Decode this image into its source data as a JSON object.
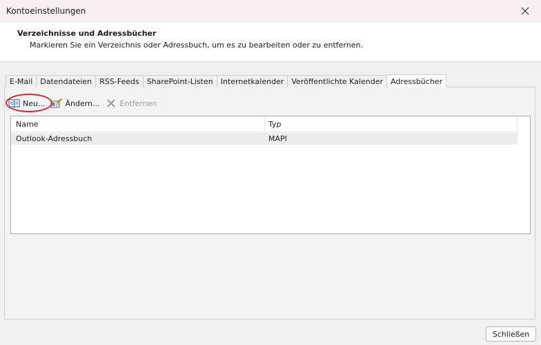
{
  "window": {
    "title": "Kontoeinstellungen",
    "close_icon": "close-icon"
  },
  "header": {
    "title": "Verzeichnisse und Adressbücher",
    "subtitle": "Markieren Sie ein Verzeichnis oder Adressbuch, um es zu bearbeiten oder zu entfernen."
  },
  "tabs": [
    {
      "label": "E-Mail",
      "active": false
    },
    {
      "label": "Datendateien",
      "active": false
    },
    {
      "label": "RSS-Feeds",
      "active": false
    },
    {
      "label": "SharePoint-Listen",
      "active": false
    },
    {
      "label": "Internetkalender",
      "active": false
    },
    {
      "label": "Veröffentlichte Kalender",
      "active": false
    },
    {
      "label": "Adressbücher",
      "active": true
    }
  ],
  "toolbar": {
    "new_label": "Neu...",
    "change_label": "Ändern...",
    "remove_label": "Entfernen",
    "new_icon": "address-book-icon",
    "change_icon": "edit-card-icon",
    "remove_icon": "x-icon"
  },
  "list": {
    "columns": [
      "Name",
      "Typ"
    ],
    "rows": [
      {
        "name": "Outlook-Adressbuch",
        "type": "MAPI"
      }
    ]
  },
  "footer": {
    "close_label": "Schließen"
  },
  "colors": {
    "highlight_ring": "#d9262c",
    "titlebar_bg": "#f7eff2",
    "selected_row": "#ececec"
  }
}
